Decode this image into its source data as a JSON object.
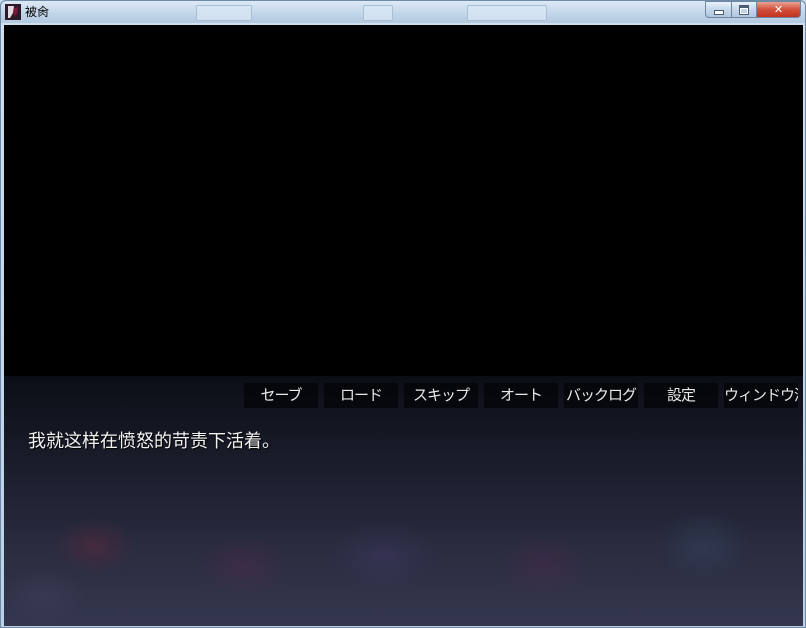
{
  "window": {
    "title": "被肏",
    "ghost_tabs": [
      "",
      "",
      ""
    ],
    "buttons": {
      "minimize": "minimize",
      "maximize": "maximize",
      "close": "✕"
    }
  },
  "game": {
    "menu": [
      {
        "id": "save",
        "label": "セーブ"
      },
      {
        "id": "load",
        "label": "ロード"
      },
      {
        "id": "skip",
        "label": "スキップ"
      },
      {
        "id": "auto",
        "label": "オート"
      },
      {
        "id": "backlog",
        "label": "バックログ"
      },
      {
        "id": "settings",
        "label": "設定"
      },
      {
        "id": "hide-window",
        "label": "ウィンドウ消去"
      }
    ],
    "message": "我就这样在愤怒的苛责下活着。"
  },
  "colors": {
    "title_bar": "#c3d6ea",
    "close_button": "#c1331f",
    "message_text": "#f2f2f2"
  }
}
